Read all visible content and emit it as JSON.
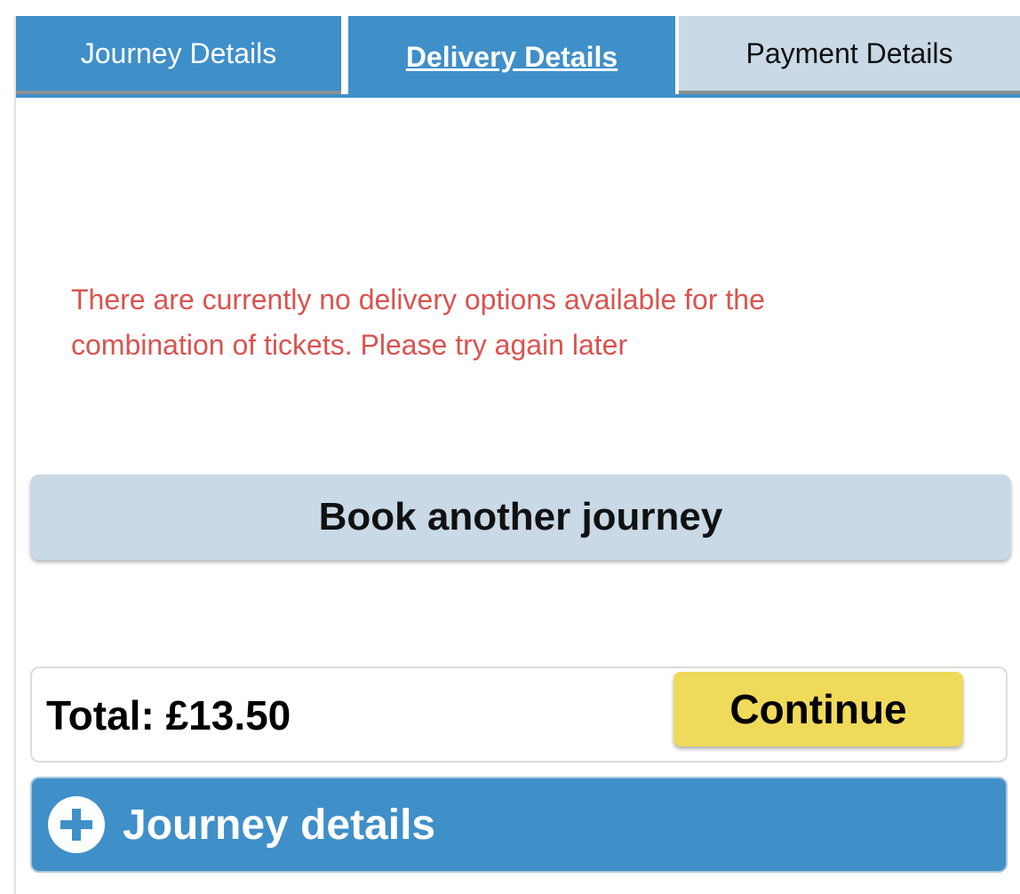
{
  "tabs": [
    {
      "label": "Journey Details"
    },
    {
      "label": "Delivery Details"
    },
    {
      "label": "Payment Details"
    }
  ],
  "message": {
    "error": "There are currently no delivery options available for the combination of tickets. Please try again later"
  },
  "actions": {
    "book_another": "Book another journey",
    "continue": "Continue"
  },
  "summary": {
    "total": "Total: £13.50"
  },
  "accordion": {
    "journey_details": "Journey details",
    "icon": "plus-circle-icon"
  },
  "colors": {
    "active_tab": "#3f8fc9",
    "inactive_tab": "#c9d9e6",
    "error": "#d9534f",
    "continue_button": "#f0da5a"
  }
}
